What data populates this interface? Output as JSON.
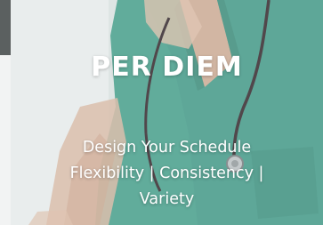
{
  "card": {
    "title": "PER DIEM",
    "subtitle_lines": [
      "Design Your Schedule",
      "Flexibility | Consistency |",
      "Variety"
    ]
  },
  "colors": {
    "scrubs": "#3f9a86",
    "overlay": "#ffffff",
    "text": "#ffffff"
  },
  "icons": {
    "background": "nurse-with-stethoscope-photo"
  }
}
